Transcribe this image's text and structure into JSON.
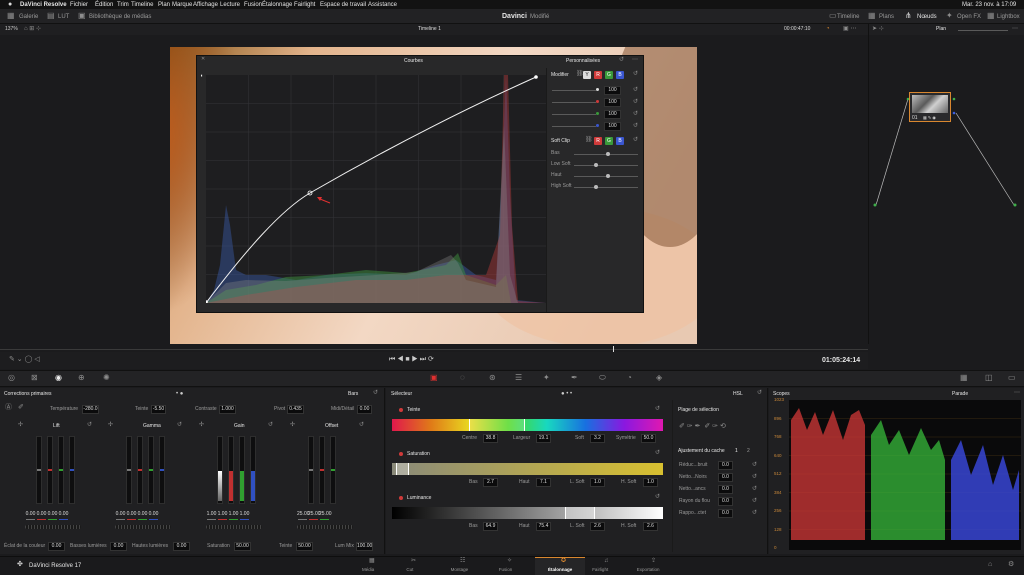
{
  "menubar": {
    "app": "DaVinci Resolve",
    "items": [
      "Fichier",
      "Édition",
      "Trim",
      "Timeline",
      "Plan",
      "Marque",
      "Affichage",
      "Lecture",
      "Fusion",
      "Étalonnage",
      "Fairlight",
      "Espace de travail",
      "Assistance"
    ],
    "clock": "Mar. 23 nov. à 17:09"
  },
  "toolbar": {
    "galerie": "Galerie",
    "lut": "LUT",
    "medias": "Bibliothèque de médias",
    "project": "Davinci",
    "status": "Modifié",
    "timeline": "Timeline",
    "plans": "Plans",
    "noeuds": "Nœuds",
    "openfx": "Open FX",
    "lightbox": "Lightbox"
  },
  "viewer": {
    "zoom": "137%",
    "timeline_name": "Timeline 1",
    "timecode_top": "00:00:47:10",
    "plan_label": "Plan",
    "timecode": "01:05:24:14"
  },
  "curves": {
    "title": "Courbes",
    "mode": "Personnalisées",
    "modifier": "Modifier",
    "values": [
      "100",
      "100",
      "100",
      "100"
    ],
    "soft_clip": "Soft Clip",
    "sliders": [
      "Bas",
      "Low Soft",
      "Haut",
      "High Soft"
    ],
    "channels": [
      "Y",
      "R",
      "G",
      "B"
    ]
  },
  "node": {
    "label": "01"
  },
  "primary": {
    "title": "Corrections primaires",
    "mode": "Bars",
    "temp_label": "Température",
    "temp": "-280.0",
    "tint_label": "Teinte",
    "tint": "-5.50",
    "contrast_label": "Contraste",
    "contrast": "1.000",
    "pivot_label": "Pivot",
    "pivot": "0.435",
    "mid_label": "Midi/Détail",
    "mid": "0.00",
    "wheels": [
      {
        "name": "Lift",
        "vals": [
          "0.00",
          "0.00",
          "0.00",
          "0.00"
        ]
      },
      {
        "name": "Gamma",
        "vals": [
          "0.00",
          "0.00",
          "0.00",
          "0.00"
        ]
      },
      {
        "name": "Gain",
        "vals": [
          "1.00",
          "1.00",
          "1.00",
          "1.00"
        ]
      },
      {
        "name": "Offset",
        "vals": [
          "25.00",
          "25.00",
          "25.00"
        ]
      }
    ],
    "bottom": [
      {
        "l": "Éclat de la couleur",
        "v": "0.00"
      },
      {
        "l": "Basses lumières",
        "v": "0.00"
      },
      {
        "l": "Hautes lumières",
        "v": "0.00"
      },
      {
        "l": "Saturation",
        "v": "50.00"
      },
      {
        "l": "Teinte",
        "v": "50.00"
      },
      {
        "l": "Lum Mix",
        "v": "100.00"
      }
    ]
  },
  "selector": {
    "title": "Sélecteur",
    "mode": "HSL",
    "hue": "Teinte",
    "hue_fields": [
      {
        "l": "Centre",
        "v": "38.8"
      },
      {
        "l": "Largeur",
        "v": "19.1"
      },
      {
        "l": "Soft",
        "v": "3.2"
      },
      {
        "l": "Symétrie",
        "v": "50.0"
      }
    ],
    "sat": "Saturation",
    "sat_fields": [
      {
        "l": "Bas",
        "v": "2.7"
      },
      {
        "l": "Haut",
        "v": "7.1"
      },
      {
        "l": "L. Soft",
        "v": "1.0"
      },
      {
        "l": "H. Soft",
        "v": "1.0"
      }
    ],
    "lum": "Luminance",
    "lum_fields": [
      {
        "l": "Bas",
        "v": "64.9"
      },
      {
        "l": "Haut",
        "v": "75.4"
      },
      {
        "l": "L. Soft",
        "v": "2.6"
      },
      {
        "l": "H. Soft",
        "v": "2.6"
      }
    ],
    "range": "Plage de sélection",
    "refine": "Ajustement du cache",
    "tabs": [
      "1",
      "2"
    ],
    "refine_rows": [
      {
        "l": "Réduc...bruit",
        "v": "0.0"
      },
      {
        "l": "Netto...Noirs",
        "v": "0.0"
      },
      {
        "l": "Netto...ancs",
        "v": "0.0"
      },
      {
        "l": "Rayon du flou",
        "v": "0.0"
      },
      {
        "l": "Rappo...ctet",
        "v": "0.0"
      }
    ]
  },
  "scopes": {
    "title": "Scopes",
    "mode": "Parade",
    "ticks": [
      "1023",
      "896",
      "768",
      "640",
      "512",
      "384",
      "256",
      "128",
      "0"
    ]
  },
  "bottombar": {
    "app": "DaVinci Resolve 17",
    "pages": [
      "Média",
      "Cut",
      "Montage",
      "Fusion",
      "Étalonnage",
      "Fairlight",
      "Exportation"
    ],
    "active": 4
  },
  "colors": {
    "accent": "#d9872f",
    "red": "#e04747",
    "green": "#3fae4a",
    "blue": "#3d5fe0"
  }
}
